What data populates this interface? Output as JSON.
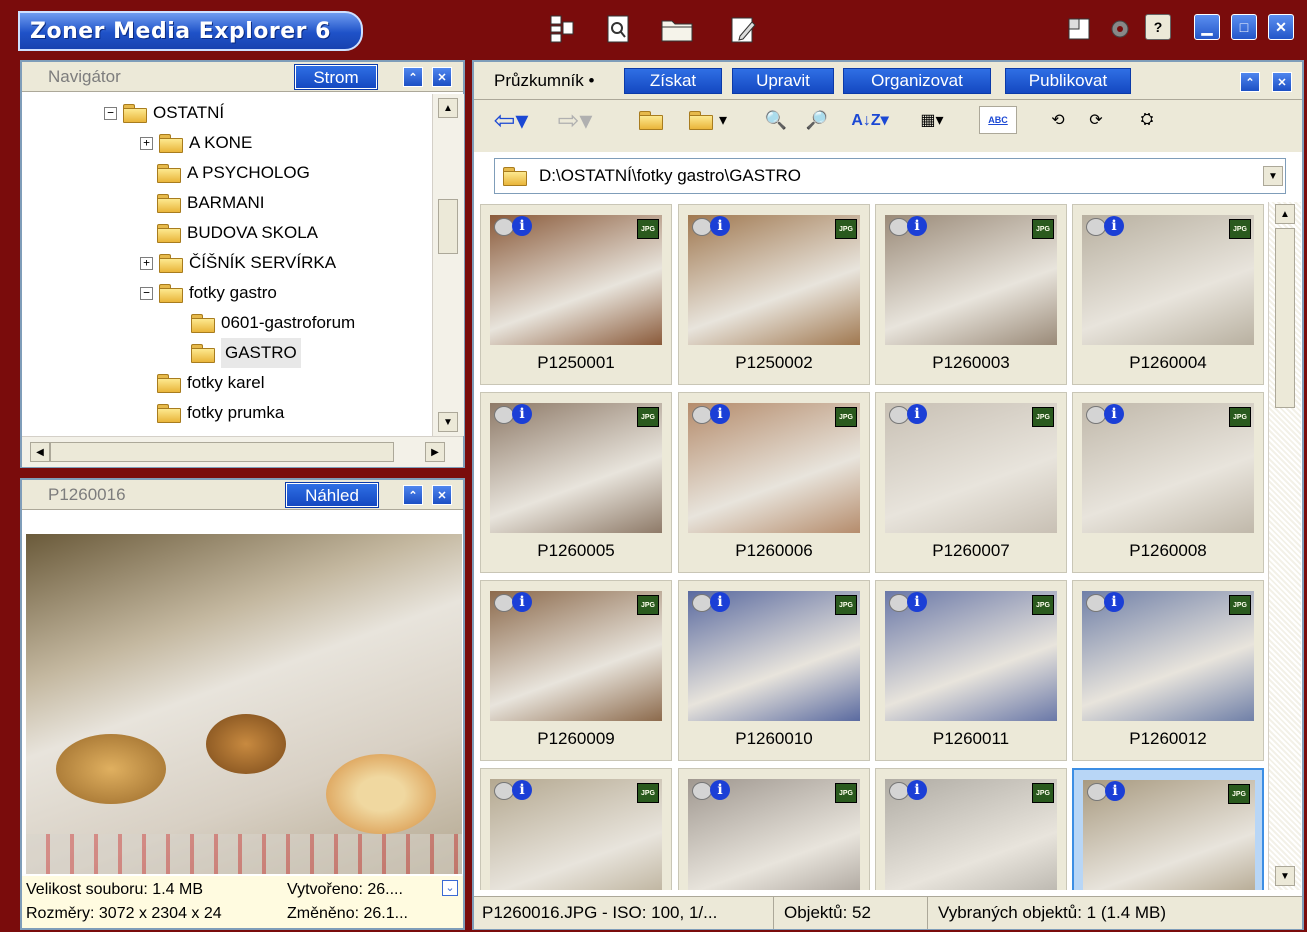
{
  "app": {
    "title": "Zoner Media Explorer 6"
  },
  "navigator": {
    "title": "Navigátor",
    "tree_button": "Strom",
    "items": [
      {
        "label": "OSTATNÍ",
        "expander": "⊟"
      },
      {
        "label": "A KONE",
        "expander": "+"
      },
      {
        "label": "A PSYCHOLOG",
        "expander": ""
      },
      {
        "label": "BARMANI",
        "expander": ""
      },
      {
        "label": "BUDOVA SKOLA",
        "expander": ""
      },
      {
        "label": "ČÍŠNÍK SERVÍRKA",
        "expander": "+"
      },
      {
        "label": "fotky gastro",
        "expander": "−"
      },
      {
        "label": "0601-gastroforum",
        "expander": ""
      },
      {
        "label": "GASTRO",
        "expander": ""
      },
      {
        "label": "fotky karel",
        "expander": ""
      },
      {
        "label": "fotky prumka",
        "expander": ""
      }
    ]
  },
  "preview": {
    "title": "P1260016",
    "button": "Náhled",
    "info": {
      "size": "Velikost souboru: 1.4 MB",
      "created": "Vytvořeno: 26....",
      "dimensions": "Rozměry: 3072 x 2304 x 24",
      "modified": "Změněno: 26.1..."
    }
  },
  "explorer": {
    "tab_label": "Průzkumník •",
    "tabs": [
      "Získat",
      "Upravit",
      "Organizovat",
      "Publikovat"
    ],
    "path": "D:\\OSTATNÍ\\fotky gastro\\GASTRO",
    "thumbnails": [
      {
        "name": "P1250001",
        "color": "#8a5a3a"
      },
      {
        "name": "P1250002",
        "color": "#a07850"
      },
      {
        "name": "P1260003",
        "color": "#9a8a78"
      },
      {
        "name": "P1260004",
        "color": "#b8b0a0"
      },
      {
        "name": "P1260005",
        "color": "#8e7a68"
      },
      {
        "name": "P1260006",
        "color": "#b58c6c"
      },
      {
        "name": "P1260007",
        "color": "#c8c0b4"
      },
      {
        "name": "P1260008",
        "color": "#c0b8aa"
      },
      {
        "name": "P1260009",
        "color": "#8c6a4c"
      },
      {
        "name": "P1260010",
        "color": "#5a6aa0"
      },
      {
        "name": "P1260011",
        "color": "#6a78a8"
      },
      {
        "name": "P1260012",
        "color": "#7080a8"
      },
      {
        "name": "",
        "color": "#b4a890"
      },
      {
        "name": "",
        "color": "#a09890"
      },
      {
        "name": "",
        "color": "#b0aca4"
      },
      {
        "name": "",
        "color": "#a89a80"
      }
    ],
    "status": {
      "file": "P1260016.JPG - ISO: 100, 1/...",
      "count": "Objektů: 52",
      "selected": "Vybraných objektů: 1 (1.4 MB)"
    }
  },
  "colors": {
    "background": "#7a0c0c",
    "accent": "#1f52c8",
    "selected": "#3c8ee4"
  }
}
